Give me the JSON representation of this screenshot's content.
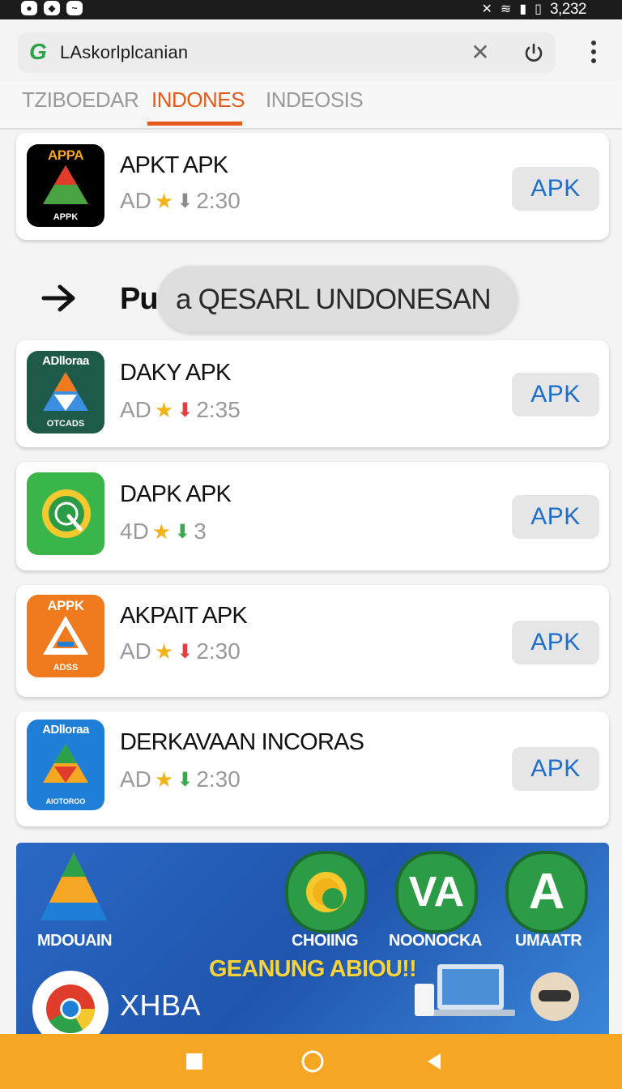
{
  "status_bar": {
    "time": "3,232",
    "left_icons": [
      "notification-icon",
      "shield-icon",
      "activity-icon"
    ],
    "right_icons": [
      "mute-icon",
      "wifi-icon",
      "signal-icon",
      "battery-icon"
    ]
  },
  "browser": {
    "url": "LAskorlplcanian",
    "icons": [
      "g-logo-icon",
      "close-icon",
      "reload-icon",
      "menu-dots-icon"
    ]
  },
  "tabs": [
    {
      "label": "TZIBOEDAR"
    },
    {
      "label": "INDONES",
      "active": true
    },
    {
      "label": "INDEOSIS"
    }
  ],
  "apps": [
    {
      "name": "APKT APK",
      "meta_prefix": "AD",
      "meta_value": "2:30",
      "button": "APK",
      "icon_top": "APPA",
      "icon_bottom": "APPK",
      "icon_bg": "#000000"
    },
    {
      "name": "DAKY APK",
      "meta_prefix": "AD",
      "meta_value": "2:35",
      "button": "APK",
      "icon_top": "ADlloraa",
      "icon_bottom": "OTCADS",
      "icon_bg": "#1e5a4a"
    },
    {
      "name": "DAPK APK",
      "meta_prefix": "4D",
      "meta_value": "3",
      "button": "APK",
      "icon_top": "",
      "icon_bottom": "",
      "icon_bg": "#3ab54a"
    },
    {
      "name": "AKPAIT APK",
      "meta_prefix": "AD",
      "meta_value": "2:30",
      "button": "APK",
      "icon_top": "APPK",
      "icon_bottom": "ADSS",
      "icon_bg": "#f07a1e"
    },
    {
      "name": "DERKAVAAN INCORAS",
      "meta_prefix": "AD",
      "meta_value": "2:30",
      "button": "APK",
      "icon_top": "ADlloraa",
      "icon_bottom": "AIOTOROO",
      "icon_bg": "#1f7fd6"
    }
  ],
  "section": {
    "title": "Pu",
    "toast": "a QESARL UNDONESAN",
    "arrow_icon": "arrow-right-icon"
  },
  "banner": {
    "items": [
      "MDOUAIN",
      "CHOIING",
      "NOONOCKA",
      "UMAATR"
    ],
    "headline": "GEANUNG ABIOU!!",
    "bottom_label": "XHBA"
  },
  "nav": [
    "square-icon",
    "circle-icon",
    "triangle-back-icon"
  ],
  "colors": {
    "accent": "#e35a1a",
    "apk_button_text": "#1e6fc9",
    "nav_bar": "#f5a623",
    "star": "#f2b31a"
  }
}
